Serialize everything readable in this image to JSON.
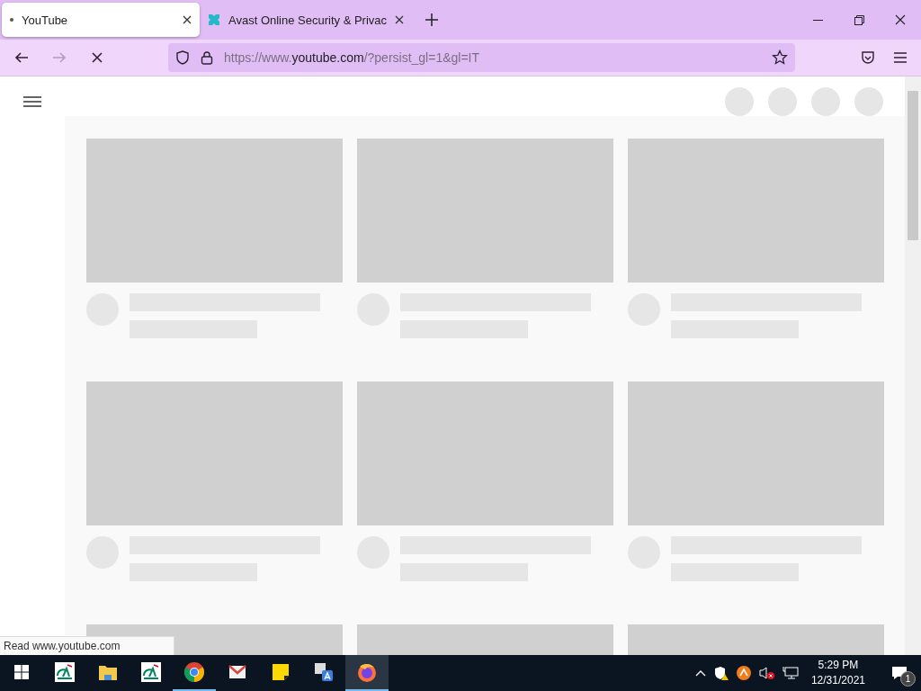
{
  "tabs": [
    {
      "title": "YouTube",
      "kind": "loading",
      "selected": true
    },
    {
      "title": "Avast Online Security & Privac",
      "kind": "avast",
      "selected": false
    }
  ],
  "nav_buttons": [
    {
      "kind": "back",
      "disabled": false
    },
    {
      "kind": "forward",
      "disabled": true
    },
    {
      "kind": "stop",
      "disabled": false
    }
  ],
  "address": {
    "url_prefix": "https://www.",
    "url_host": "youtube.com",
    "url_rest": "/?persist_gl=1&gl=IT"
  },
  "status_text": "Read www.youtube.com",
  "taskbar_apps": [
    {
      "kind": "ca",
      "running": false,
      "selected": false
    },
    {
      "kind": "folder",
      "running": false,
      "selected": false
    },
    {
      "kind": "ca",
      "running": false,
      "selected": false
    },
    {
      "kind": "chrome",
      "running": true,
      "selected": false
    },
    {
      "kind": "mail",
      "running": false,
      "selected": false
    },
    {
      "kind": "notes",
      "running": false,
      "selected": false
    },
    {
      "kind": "translate",
      "running": false,
      "selected": false
    },
    {
      "kind": "firefox",
      "running": true,
      "selected": true
    }
  ],
  "clock": {
    "time": "5:29 PM",
    "date": "12/31/2021"
  },
  "notifications": {
    "count": "1"
  }
}
